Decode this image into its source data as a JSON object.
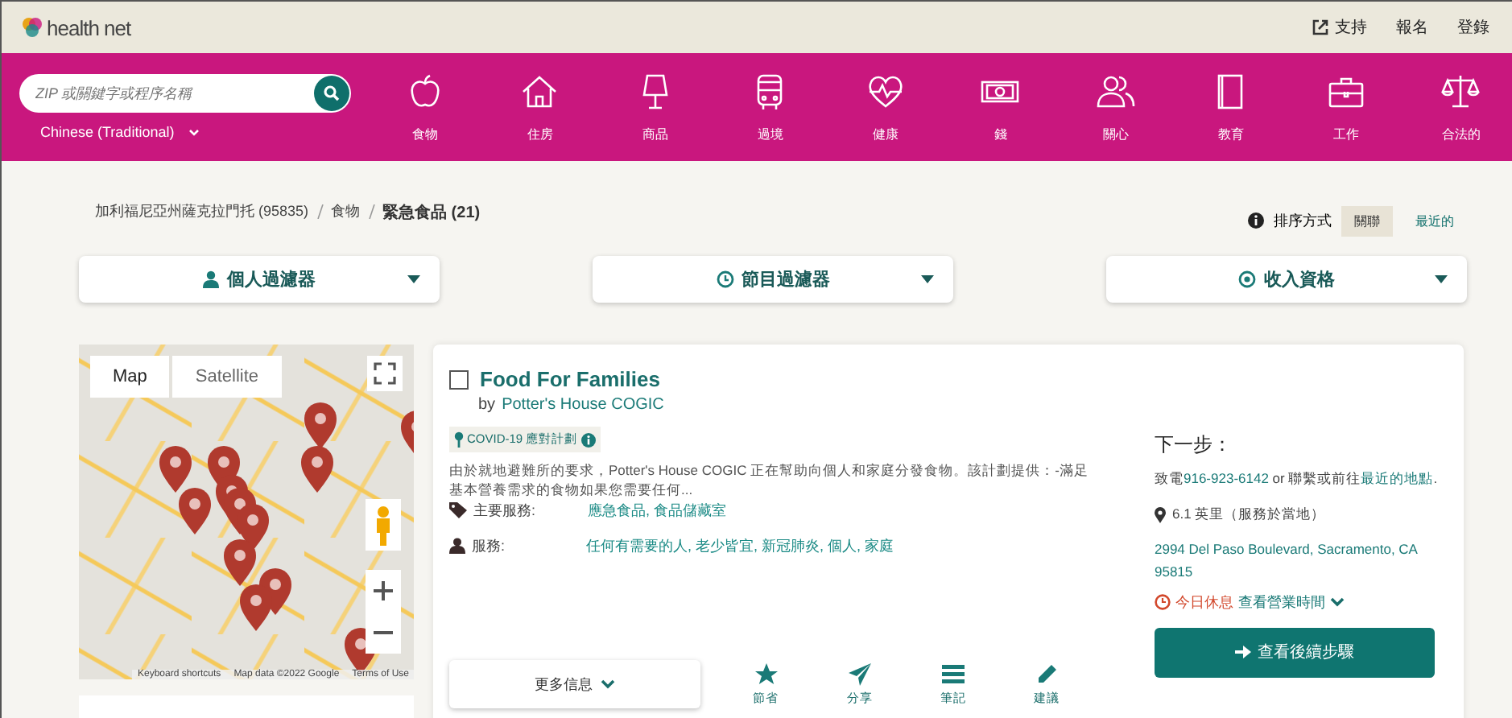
{
  "topbar": {
    "logo": "health net",
    "links": [
      "支持",
      "報名",
      "登錄"
    ]
  },
  "header": {
    "search": {
      "placeholder": "ZIP 或關鍵字或程序名稱"
    },
    "language": "Chinese (Traditional)",
    "categories": [
      {
        "label": "食物"
      },
      {
        "label": "住房"
      },
      {
        "label": "商品"
      },
      {
        "label": "過境"
      },
      {
        "label": "健康"
      },
      {
        "label": "錢"
      },
      {
        "label": "關心"
      },
      {
        "label": "教育"
      },
      {
        "label": "工作"
      },
      {
        "label": "合法的"
      }
    ]
  },
  "breadcrumb": [
    "加利福尼亞州薩克拉門托 (95835)",
    "食物",
    "緊急食品 (21)"
  ],
  "sort": {
    "label": "排序方式",
    "options": [
      {
        "label": "關聯",
        "selected": true
      },
      {
        "label": "最近的",
        "selected": false
      }
    ]
  },
  "filters": [
    "個人過濾器",
    "節目過濾器",
    "收入資格"
  ],
  "map": {
    "types": [
      {
        "label": "Map",
        "selected": true
      },
      {
        "label": "Satellite",
        "selected": false
      }
    ],
    "credits": [
      "Keyboard shortcuts",
      "Map data ©2022 Google",
      "Terms of Use"
    ]
  },
  "result": {
    "checked": false,
    "title": "Food For Families",
    "by": "by",
    "org": "Potter's House COGIC",
    "tag": "COVID-19 應對計劃",
    "description": "由於就地避難所的要求，Potter's House COGIC 正在幫助向個人和家庭分發食物。該計劃提供：-滿足基本營養需求的食物如果您需要任何...",
    "rows": [
      {
        "kind": "tag",
        "label": "主要服務:",
        "value": "應急食品, 食品儲藏室"
      },
      {
        "kind": "person",
        "label": "服務:",
        "value": "任何有需要的人, 老少皆宜, 新冠肺炎, 個人, 家庭"
      }
    ],
    "more": "更多信息",
    "actions": [
      {
        "kind": "star",
        "label": "節省"
      },
      {
        "kind": "send",
        "label": "分享"
      },
      {
        "kind": "list",
        "label": "筆記"
      },
      {
        "kind": "pencil",
        "label": "建議"
      }
    ],
    "next": {
      "heading": "下一步：",
      "call": "致電",
      "phone": "916-923-6142",
      "middle": " or 聯繫或前往",
      "nearest": "最近的地點",
      "end": ".",
      "distance": "6.1 英里（服務於當地）",
      "address": "2994 Del Paso Boulevard, Sacramento, CA 95815",
      "closed": "今日休息",
      "hours": "查看營業時間",
      "button": "查看後續步驟"
    }
  }
}
